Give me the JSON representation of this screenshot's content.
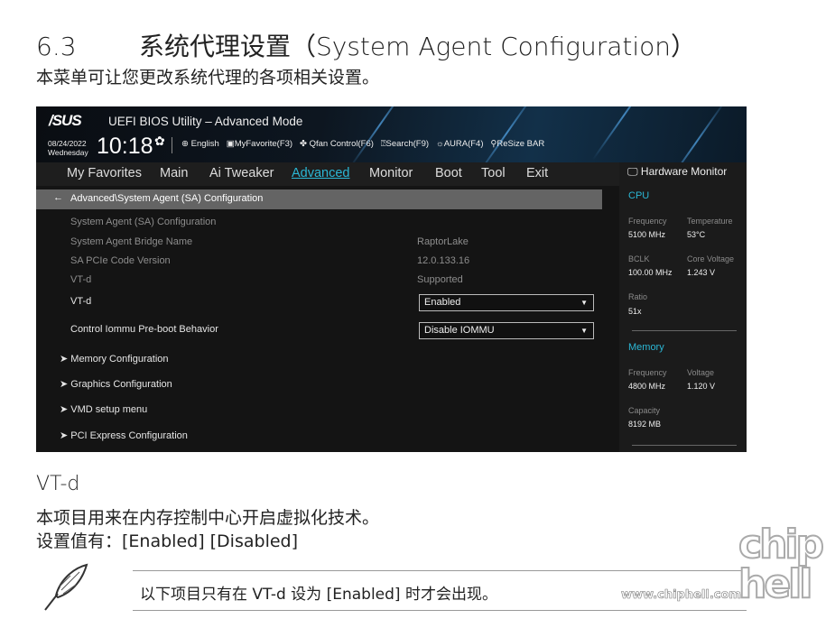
{
  "doc": {
    "section_number": "6.3",
    "section_title": "系统代理设置（System Agent Configuration）",
    "intro": "本菜单可让您更改系统代理的各项相关设置。",
    "item_title": "VT-d",
    "item_desc": "本项目用来在内存控制中心开启虚拟化技术。",
    "item_values": "设置值有：[Enabled] [Disabled]",
    "note": "以下项目只有在 VT-d 设为 [Enabled] 时才会出现。",
    "watermark": "www.chiphell.com",
    "watermark_logo": "chip hell"
  },
  "bios": {
    "brand": "/SUS",
    "title": "UEFI BIOS Utility – Advanced Mode",
    "date": "08/24/2022",
    "day": "Wednesday",
    "time": "10:18",
    "toolbar": [
      "English",
      "MyFavorite(F3)",
      "Qfan Control(F6)",
      "Search(F9)",
      "AURA(F4)",
      "ReSize BAR"
    ],
    "menu": [
      "My Favorites",
      "Main",
      "Ai Tweaker",
      "Advanced",
      "Monitor",
      "Boot",
      "Tool",
      "Exit"
    ],
    "active_menu": "Advanced",
    "breadcrumb": "Advanced\\System Agent (SA) Configuration",
    "info_rows": [
      {
        "label": "System Agent (SA) Configuration",
        "value": ""
      },
      {
        "label": "System Agent Bridge Name",
        "value": "RaptorLake"
      },
      {
        "label": "SA PCIe Code Version",
        "value": "12.0.133.16"
      },
      {
        "label": "VT-d",
        "value": "Supported"
      }
    ],
    "settings": [
      {
        "label": "VT-d",
        "value": "Enabled"
      },
      {
        "label": "Control Iommu Pre-boot Behavior",
        "value": "Disable IOMMU"
      }
    ],
    "submenus": [
      "Memory Configuration",
      "Graphics Configuration",
      "VMD setup menu",
      "PCI Express Configuration"
    ],
    "accent": "#2bb7d5",
    "hw": {
      "title": "Hardware Monitor",
      "cpu_title": "CPU",
      "cpu": [
        {
          "label": "Frequency",
          "value": "5100 MHz"
        },
        {
          "label": "Temperature",
          "value": "53°C"
        },
        {
          "label": "BCLK",
          "value": "100.00 MHz"
        },
        {
          "label": "Core Voltage",
          "value": "1.243 V"
        },
        {
          "label": "Ratio",
          "value": "51x"
        }
      ],
      "mem_title": "Memory",
      "mem": [
        {
          "label": "Frequency",
          "value": "4800 MHz"
        },
        {
          "label": "Voltage",
          "value": "1.120 V"
        },
        {
          "label": "Capacity",
          "value": "8192 MB"
        }
      ]
    }
  }
}
